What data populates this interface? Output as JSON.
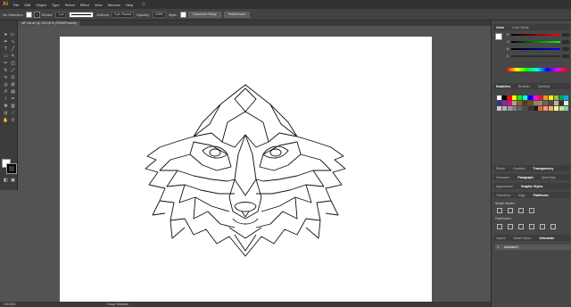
{
  "app": {
    "logo": "Ai"
  },
  "menu": [
    "File",
    "Edit",
    "Object",
    "Type",
    "Select",
    "Effect",
    "View",
    "Window",
    "Help"
  ],
  "control_bar": {
    "selection": "No Selection",
    "stroke_label": "Stroke:",
    "stroke_value": "1 pt",
    "profile_label": "Uniform",
    "brush_label": "5 pt. Round",
    "opacity_label": "Opacity:",
    "opacity_value": "100%",
    "style_label": "Style:",
    "document_setup": "Document Setup",
    "preferences": "Preferences"
  },
  "document_tab": {
    "label": "WF Art.ai* @ 104.16 % (RGB/Preview)"
  },
  "status_bar": {
    "zoom": "104.16%",
    "tool": "Group Selection"
  },
  "panels": {
    "color_tabs": [
      "Color",
      "Color Guide"
    ],
    "swatch_tabs": [
      "Swatches",
      "Brushes",
      "Symbols"
    ],
    "stroke_tabs": [
      "Stroke",
      "Gradient",
      "Transparency"
    ],
    "char_tabs": [
      "Character",
      "Paragraph",
      "OpenType"
    ],
    "appearance_tabs": [
      "Appearance",
      "Graphic Styles"
    ],
    "transform_tabs": [
      "Transform",
      "Align",
      "Pathfinder"
    ],
    "shape_modes_label": "Shape Modes:",
    "pathfinders_label": "Pathfinders:",
    "layers_tabs": [
      "Layers",
      "Asset Export",
      "Artboards"
    ],
    "artboard_row": {
      "index": "1",
      "name": "Artboard 1"
    }
  },
  "colors": {
    "menubar": "#323232",
    "controlbar": "#424242",
    "canvas": "#535353",
    "artboard": "#ffffff",
    "line_art": "#111111",
    "accent": "#ff9a00"
  },
  "icons": [
    "home-icon",
    "selection-icon",
    "direct-selection-icon",
    "pen-icon",
    "type-icon",
    "line-icon",
    "rectangle-icon",
    "brush-icon",
    "pencil-icon",
    "eraser-icon",
    "rotate-icon",
    "scale-icon",
    "width-icon",
    "free-transform-icon",
    "shape-builder-icon",
    "perspective-icon",
    "mesh-icon",
    "gradient-icon",
    "eyedropper-icon",
    "blend-icon",
    "symbol-sprayer-icon",
    "graph-icon",
    "artboard-icon",
    "slice-icon",
    "hand-icon",
    "zoom-icon"
  ]
}
